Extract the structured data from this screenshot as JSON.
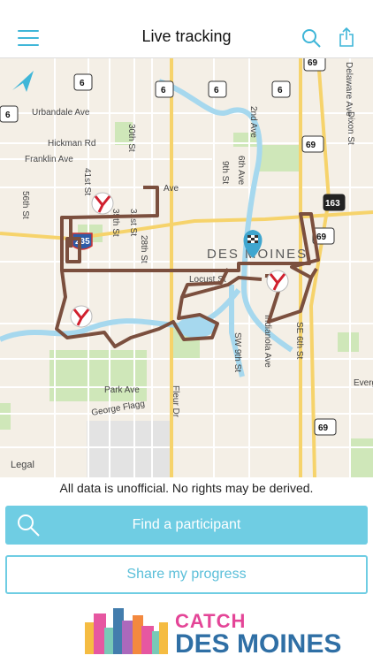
{
  "header": {
    "title": "Live tracking",
    "menu_icon": "hamburger-menu-icon",
    "search_icon": "search-icon",
    "share_icon": "share-icon",
    "accent_color": "#3fb6d8"
  },
  "map": {
    "city_label": "DES MOINES",
    "legal": "Legal",
    "streets": [
      "Urbandale Ave",
      "Hickman Rd",
      "Franklin Ave",
      "Ave",
      "56th St",
      "41st St",
      "35th St",
      "31st St",
      "30th St",
      "28th St",
      "2nd Ave",
      "6th Ave",
      "9th St",
      "Dixon St",
      "Locust St",
      "George Flagg",
      "Park Ave",
      "Fleur Dr",
      "SW 9th St",
      "Indianola Ave",
      "SE 6th St",
      "Evergreen",
      "Delaware Ave"
    ],
    "highway_shields": [
      "6",
      "6",
      "6",
      "6",
      "6",
      "69",
      "69",
      "69",
      "69",
      "163",
      "235"
    ],
    "route_color": "#7b4f3e",
    "marker_icons": [
      "y-marker-icon",
      "y-marker-icon",
      "y-marker-icon",
      "finish-flag-icon"
    ]
  },
  "footer": {
    "disclaimer": "All data is unofficial. No rights may be derived.",
    "find_button": "Find a participant",
    "share_button": "Share my progress",
    "logo_line1": "CATCH",
    "logo_line2": "DES MOINES"
  }
}
